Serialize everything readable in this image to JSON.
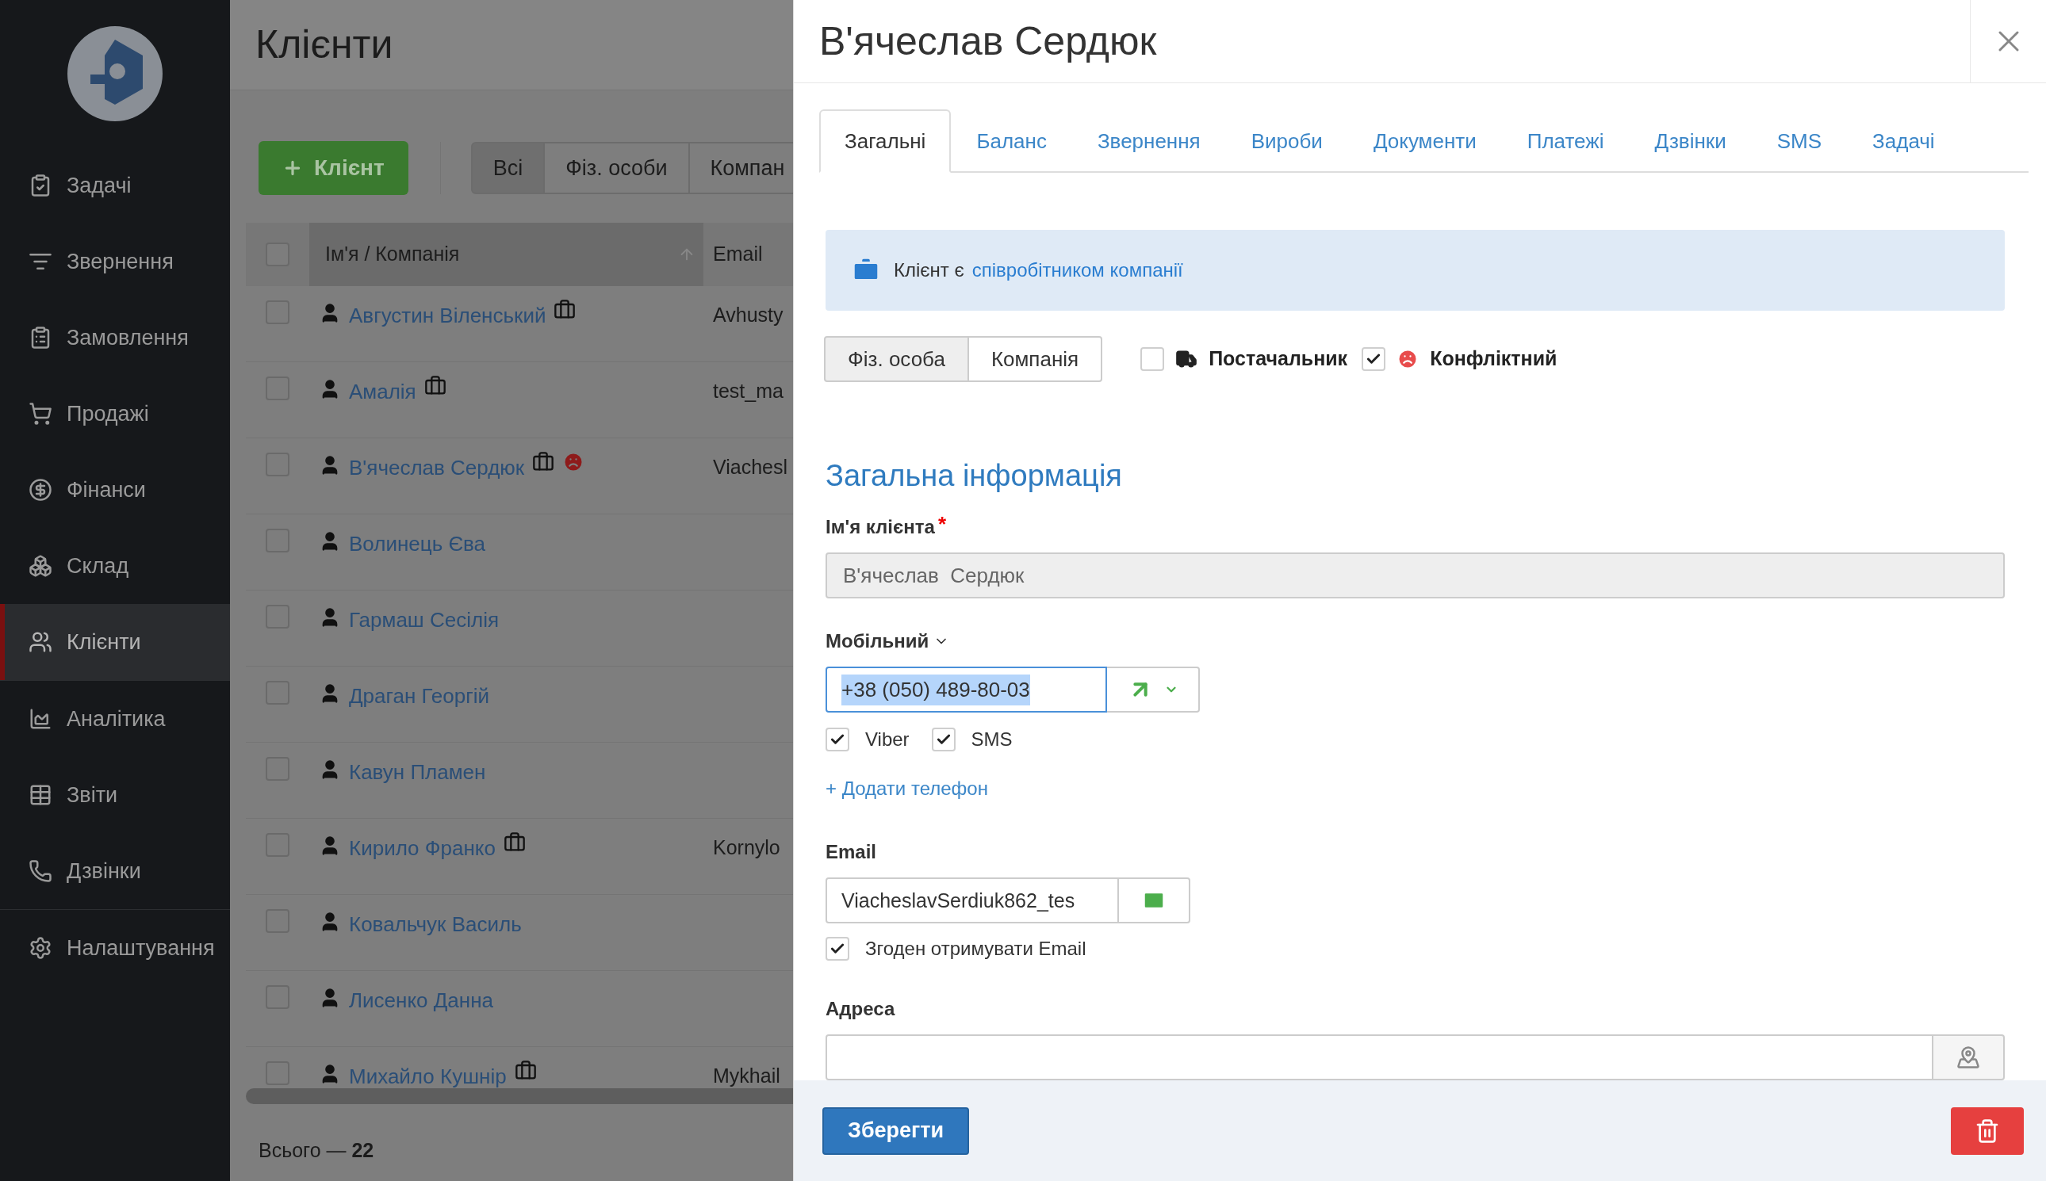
{
  "sidebar": {
    "nav_groups": [
      [
        {
          "label": "Задачі",
          "selected": false
        },
        {
          "label": "Звернення",
          "selected": false
        },
        {
          "label": "Замовлення",
          "selected": false
        },
        {
          "label": "Продажі",
          "selected": false
        },
        {
          "label": "Фінанси",
          "selected": false
        },
        {
          "label": "Склад",
          "selected": false
        },
        {
          "label": "Клієнти",
          "selected": true
        }
      ],
      [
        {
          "label": "Аналітика",
          "selected": false
        },
        {
          "label": "Звіти",
          "selected": false
        },
        {
          "label": "Дзвінки",
          "selected": false
        }
      ],
      [
        {
          "label": "Налаштування",
          "selected": false
        }
      ]
    ]
  },
  "page": {
    "title": "Клієнти",
    "add_button": "Клієнт",
    "filters": [
      {
        "label": "Всі",
        "selected": true
      },
      {
        "label": "Фіз. особи",
        "selected": false
      },
      {
        "label": "Компан",
        "selected": false
      }
    ],
    "table": {
      "columns": [
        "Ім'я / Компанія",
        "Email"
      ],
      "header_checked": false,
      "rows": [
        {
          "checked": false,
          "name": "Августин Віленський",
          "employee": true,
          "conflict": false,
          "email": "Avhusty"
        },
        {
          "checked": false,
          "name": "Амалія",
          "employee": true,
          "conflict": false,
          "email": "test_ma"
        },
        {
          "checked": false,
          "name": "В'ячеслав Сердюк",
          "employee": true,
          "conflict": true,
          "email": "Viachesl"
        },
        {
          "checked": false,
          "name": "Волинець Єва",
          "employee": false,
          "conflict": false
        },
        {
          "checked": false,
          "name": "Гармаш Сесілія",
          "employee": false,
          "conflict": false
        },
        {
          "checked": false,
          "name": "Драган Георгій",
          "employee": false,
          "conflict": false
        },
        {
          "checked": false,
          "name": "Кавун Пламен",
          "employee": false,
          "conflict": false
        },
        {
          "checked": false,
          "name": "Кирило Франко",
          "employee": true,
          "conflict": false,
          "email": "Kornylo"
        },
        {
          "checked": false,
          "name": "Ковальчук Василь",
          "employee": false,
          "conflict": false
        },
        {
          "checked": false,
          "name": "Лисенко Данна",
          "employee": false,
          "conflict": false
        },
        {
          "checked": false,
          "name": "Михайло Кушнір",
          "employee": true,
          "conflict": false,
          "email": "Mykhail"
        }
      ]
    },
    "total": "Всього — **22**"
  },
  "modal": {
    "title": "В'ячеслав Сердюк",
    "tabs": [
      {
        "label": "Загальні",
        "selected": true
      },
      {
        "label": "Баланс",
        "selected": false
      },
      {
        "label": "Звернення",
        "selected": false
      },
      {
        "label": "Вироби",
        "selected": false
      },
      {
        "label": "Документи",
        "selected": false
      },
      {
        "label": "Платежі",
        "selected": false
      },
      {
        "label": "Дзвінки",
        "selected": false
      },
      {
        "label": "SMS",
        "selected": false
      },
      {
        "label": "Задачі",
        "selected": false
      }
    ],
    "alert": {
      "text": "Клієнт є",
      "link": "співробітником компанії"
    },
    "client_type": [
      {
        "label": "Фіз. особа",
        "selected": true
      },
      {
        "label": "Компанія",
        "selected": false
      }
    ],
    "flags": [
      {
        "kind": "supplier",
        "label": "Постачальник",
        "checked": false
      },
      {
        "kind": "conflict",
        "label": "Конфліктний",
        "checked": true
      }
    ],
    "section_title": "Загальна інформація",
    "name_field": {
      "label": "Ім'я клієнта",
      "required_mark": "*",
      "value": "В'ячеслав  Сердюк",
      "disabled": true
    },
    "phone": {
      "label": "Мобільний",
      "value": "+38 (050) 489-80-03",
      "value_selected": true,
      "channels": [
        {
          "label": "Viber",
          "checked": true
        },
        {
          "label": "SMS",
          "checked": true
        }
      ],
      "add_link": "+ Додати телефон"
    },
    "email": {
      "label": "Email",
      "value": "ViacheslavSerdiuk862_tes",
      "consent": {
        "label": "Згоден отримувати Email",
        "checked": true
      }
    },
    "address": {
      "label": "Адреса"
    },
    "save_button": "Зберегти"
  }
}
